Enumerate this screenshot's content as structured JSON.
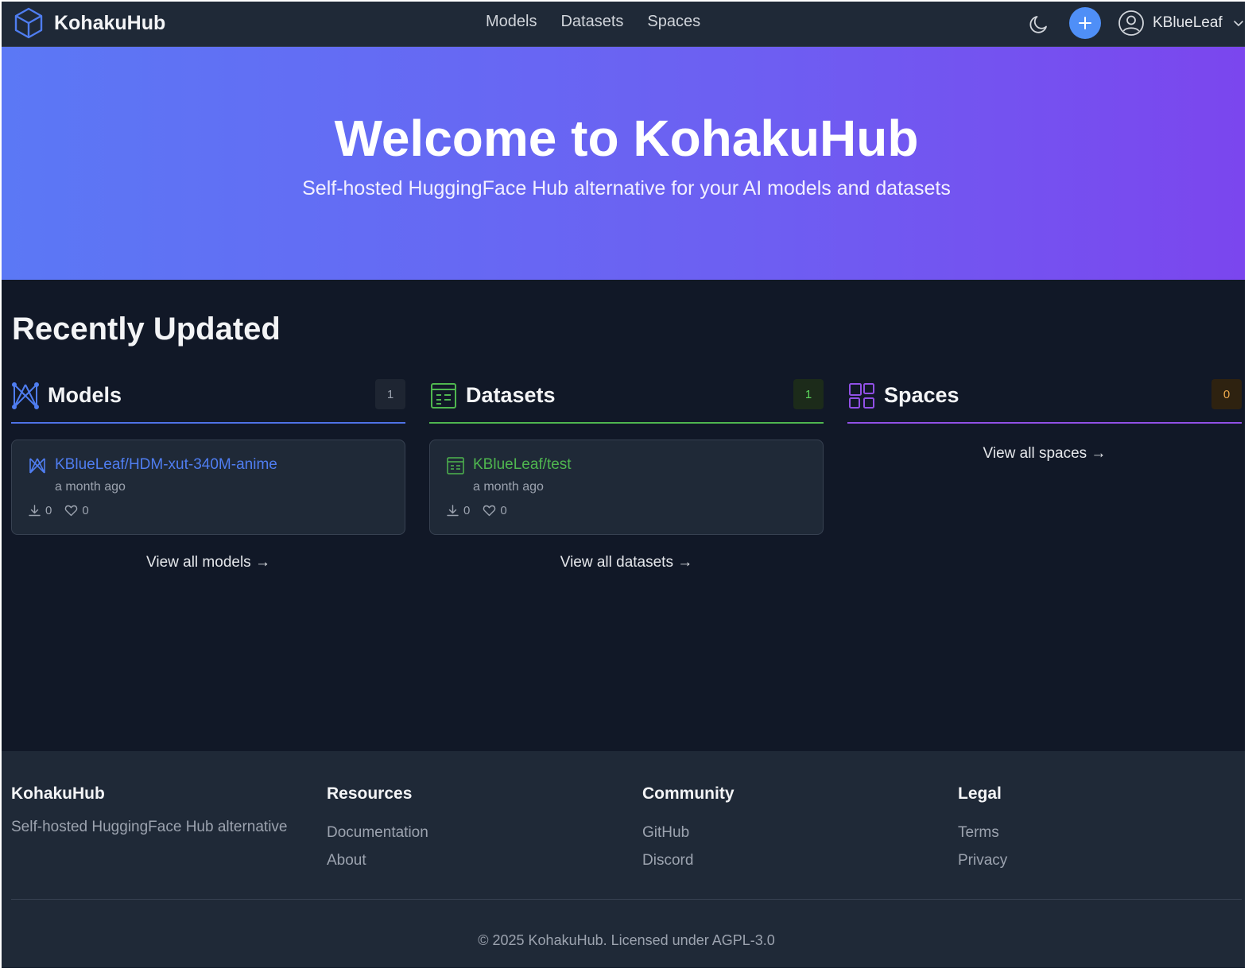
{
  "header": {
    "brand": "KohakuHub",
    "nav": [
      "Models",
      "Datasets",
      "Spaces"
    ],
    "user": "KBlueLeaf"
  },
  "hero": {
    "title": "Welcome to KohakuHub",
    "subtitle": "Self-hosted HuggingFace Hub alternative for your AI models and datasets"
  },
  "recent": {
    "title": "Recently Updated",
    "models": {
      "heading": "Models",
      "count": "1",
      "items": [
        {
          "name": "KBlueLeaf/HDM-xut-340M-anime",
          "updated": "a month ago",
          "downloads": "0",
          "likes": "0"
        }
      ],
      "view_all": "View all models →"
    },
    "datasets": {
      "heading": "Datasets",
      "count": "1",
      "items": [
        {
          "name": "KBlueLeaf/test",
          "updated": "a month ago",
          "downloads": "0",
          "likes": "0"
        }
      ],
      "view_all": "View all datasets →"
    },
    "spaces": {
      "heading": "Spaces",
      "count": "0",
      "items": [],
      "view_all": "View all spaces →"
    }
  },
  "footer": {
    "brand": {
      "title": "KohakuHub",
      "desc": "Self-hosted HuggingFace Hub alternative"
    },
    "resources": {
      "title": "Resources",
      "links": [
        "Documentation",
        "About"
      ]
    },
    "community": {
      "title": "Community",
      "links": [
        "GitHub",
        "Discord"
      ]
    },
    "legal": {
      "title": "Legal",
      "links": [
        "Terms",
        "Privacy"
      ]
    },
    "copyright": "© 2025 KohakuHub. Licensed under AGPL-3.0"
  },
  "colors": {
    "models_accent": "#4f72e6",
    "datasets_accent": "#4fb64f",
    "spaces_accent": "#9150e6",
    "primary_button": "#4f8ff7"
  },
  "icons": {
    "logo": "cube-icon",
    "theme": "moon-icon",
    "add": "plus-icon",
    "user": "user-circle-icon",
    "models": "model-network-icon",
    "datasets": "dataset-table-icon",
    "spaces": "spaces-grid-icon",
    "downloads": "download-icon",
    "likes": "heart-icon"
  }
}
